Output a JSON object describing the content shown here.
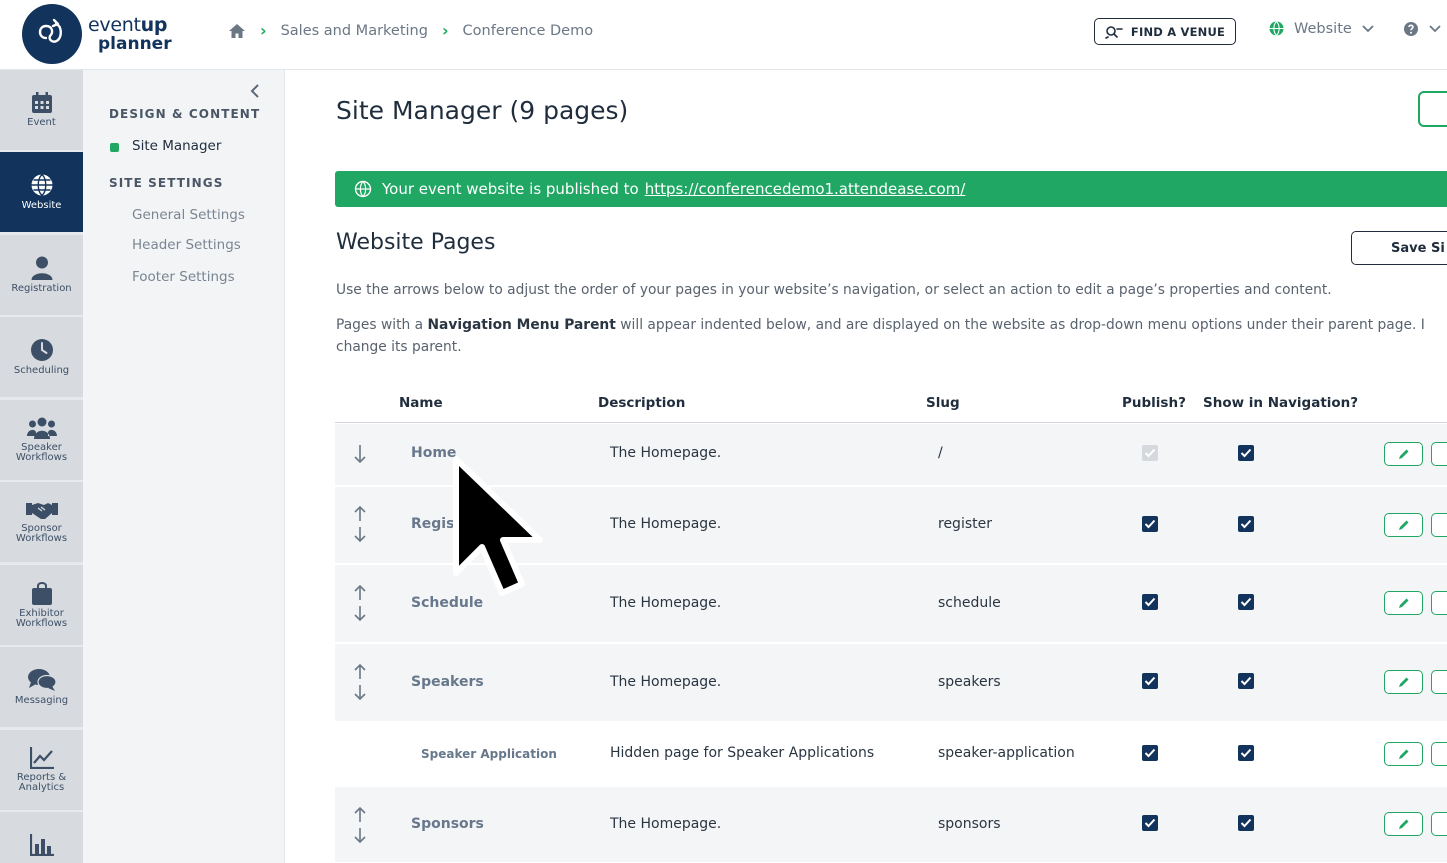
{
  "brand": {
    "line1_a": "event",
    "line1_b": "up",
    "line2": "planner"
  },
  "breadcrumb": [
    "Sales and Marketing",
    "Conference Demo"
  ],
  "header": {
    "find_venue": "FIND A VENUE",
    "site_select": "Website"
  },
  "rail": [
    {
      "label": "Event",
      "icon": "calendar-icon"
    },
    {
      "label": "Website",
      "icon": "globe-icon",
      "active": true
    },
    {
      "label": "Registration",
      "icon": "person-icon"
    },
    {
      "label": "Scheduling",
      "icon": "clock-icon"
    },
    {
      "label": "Speaker Workflows",
      "icon": "group-icon"
    },
    {
      "label": "Sponsor Workflows",
      "icon": "handshake-icon"
    },
    {
      "label": "Exhibitor Workflows",
      "icon": "bag-icon"
    },
    {
      "label": "Messaging",
      "icon": "chat-icon"
    },
    {
      "label": "Reports & Analytics",
      "icon": "line-chart-icon"
    }
  ],
  "sidebar": {
    "design_heading": "DESIGN & CONTENT",
    "site_manager": "Site Manager",
    "settings_heading": "SITE SETTINGS",
    "items": [
      "General Settings",
      "Header Settings",
      "Footer Settings"
    ]
  },
  "main": {
    "title": "Site Manager (9 pages)",
    "banner_text": "Your event website is published to",
    "banner_url": "https://conferencedemo1.attendease.com/",
    "section_title": "Website Pages",
    "save_label": "Save Si",
    "para1": "Use the arrows below to adjust the order of your pages in your website’s navigation, or select an action to edit a page’s properties and content.",
    "para2_a": "Pages with a ",
    "para2_bold": "Navigation Menu Parent",
    "para2_b": " will appear indented below, and are displayed on the website as drop-down menu options under their parent page. I",
    "para3": "change its parent."
  },
  "table": {
    "headers": {
      "name": "Name",
      "description": "Description",
      "slug": "Slug",
      "publish": "Publish?",
      "nav": "Show in Navigation?"
    },
    "rows": [
      {
        "name": "Home",
        "description": "The Homepage.",
        "slug": "/",
        "publish": true,
        "publish_disabled": true,
        "nav": true
      },
      {
        "name": "Regis",
        "description": "The Homepage.",
        "slug": "register",
        "publish": true,
        "nav": true
      },
      {
        "name": "Schedule",
        "description": "The Homepage.",
        "slug": "schedule",
        "publish": true,
        "nav": true
      },
      {
        "name": "Speakers",
        "description": "The Homepage.",
        "slug": "speakers",
        "publish": true,
        "nav": true
      },
      {
        "name": "Speaker Application",
        "description": "Hidden page for Speaker Applications",
        "slug": "speaker-application",
        "publish": true,
        "nav": true,
        "child": true
      },
      {
        "name": "Sponsors",
        "description": "The Homepage.",
        "slug": "sponsors",
        "publish": true,
        "nav": true
      }
    ]
  },
  "colors": {
    "navy": "#12335c",
    "green": "#1fa763",
    "rail_bg": "#d7dbe0"
  }
}
